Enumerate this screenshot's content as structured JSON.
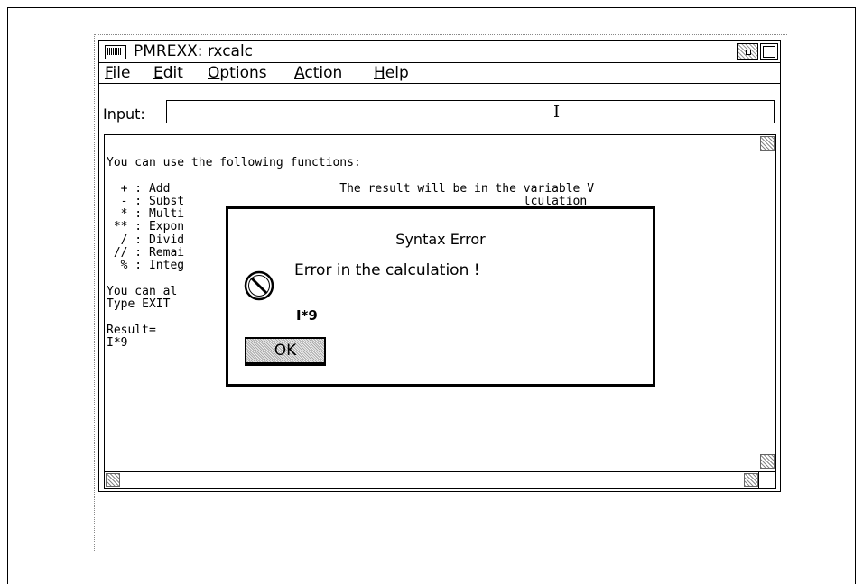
{
  "window": {
    "title": "PMREXX: rxcalc"
  },
  "menu": [
    "File",
    "Edit",
    "Options",
    "Action",
    "Help"
  ],
  "input": {
    "label": "Input:",
    "value": ""
  },
  "output_text": "You can use the following functions:\n\n  + : Add                        The result will be in the variable V\n  - : Subst                                                lculation\n  * : Multi\n ** : Expon\n  / : Divid\n // : Remai\n  % : Integ\n\nYou can al\nType EXIT\n\nResult=\nI*9",
  "dialog": {
    "title": "Syntax Error",
    "message": "Error in the calculation !",
    "expression": "I*9",
    "ok_label": "OK",
    "icon": "stop-icon"
  }
}
